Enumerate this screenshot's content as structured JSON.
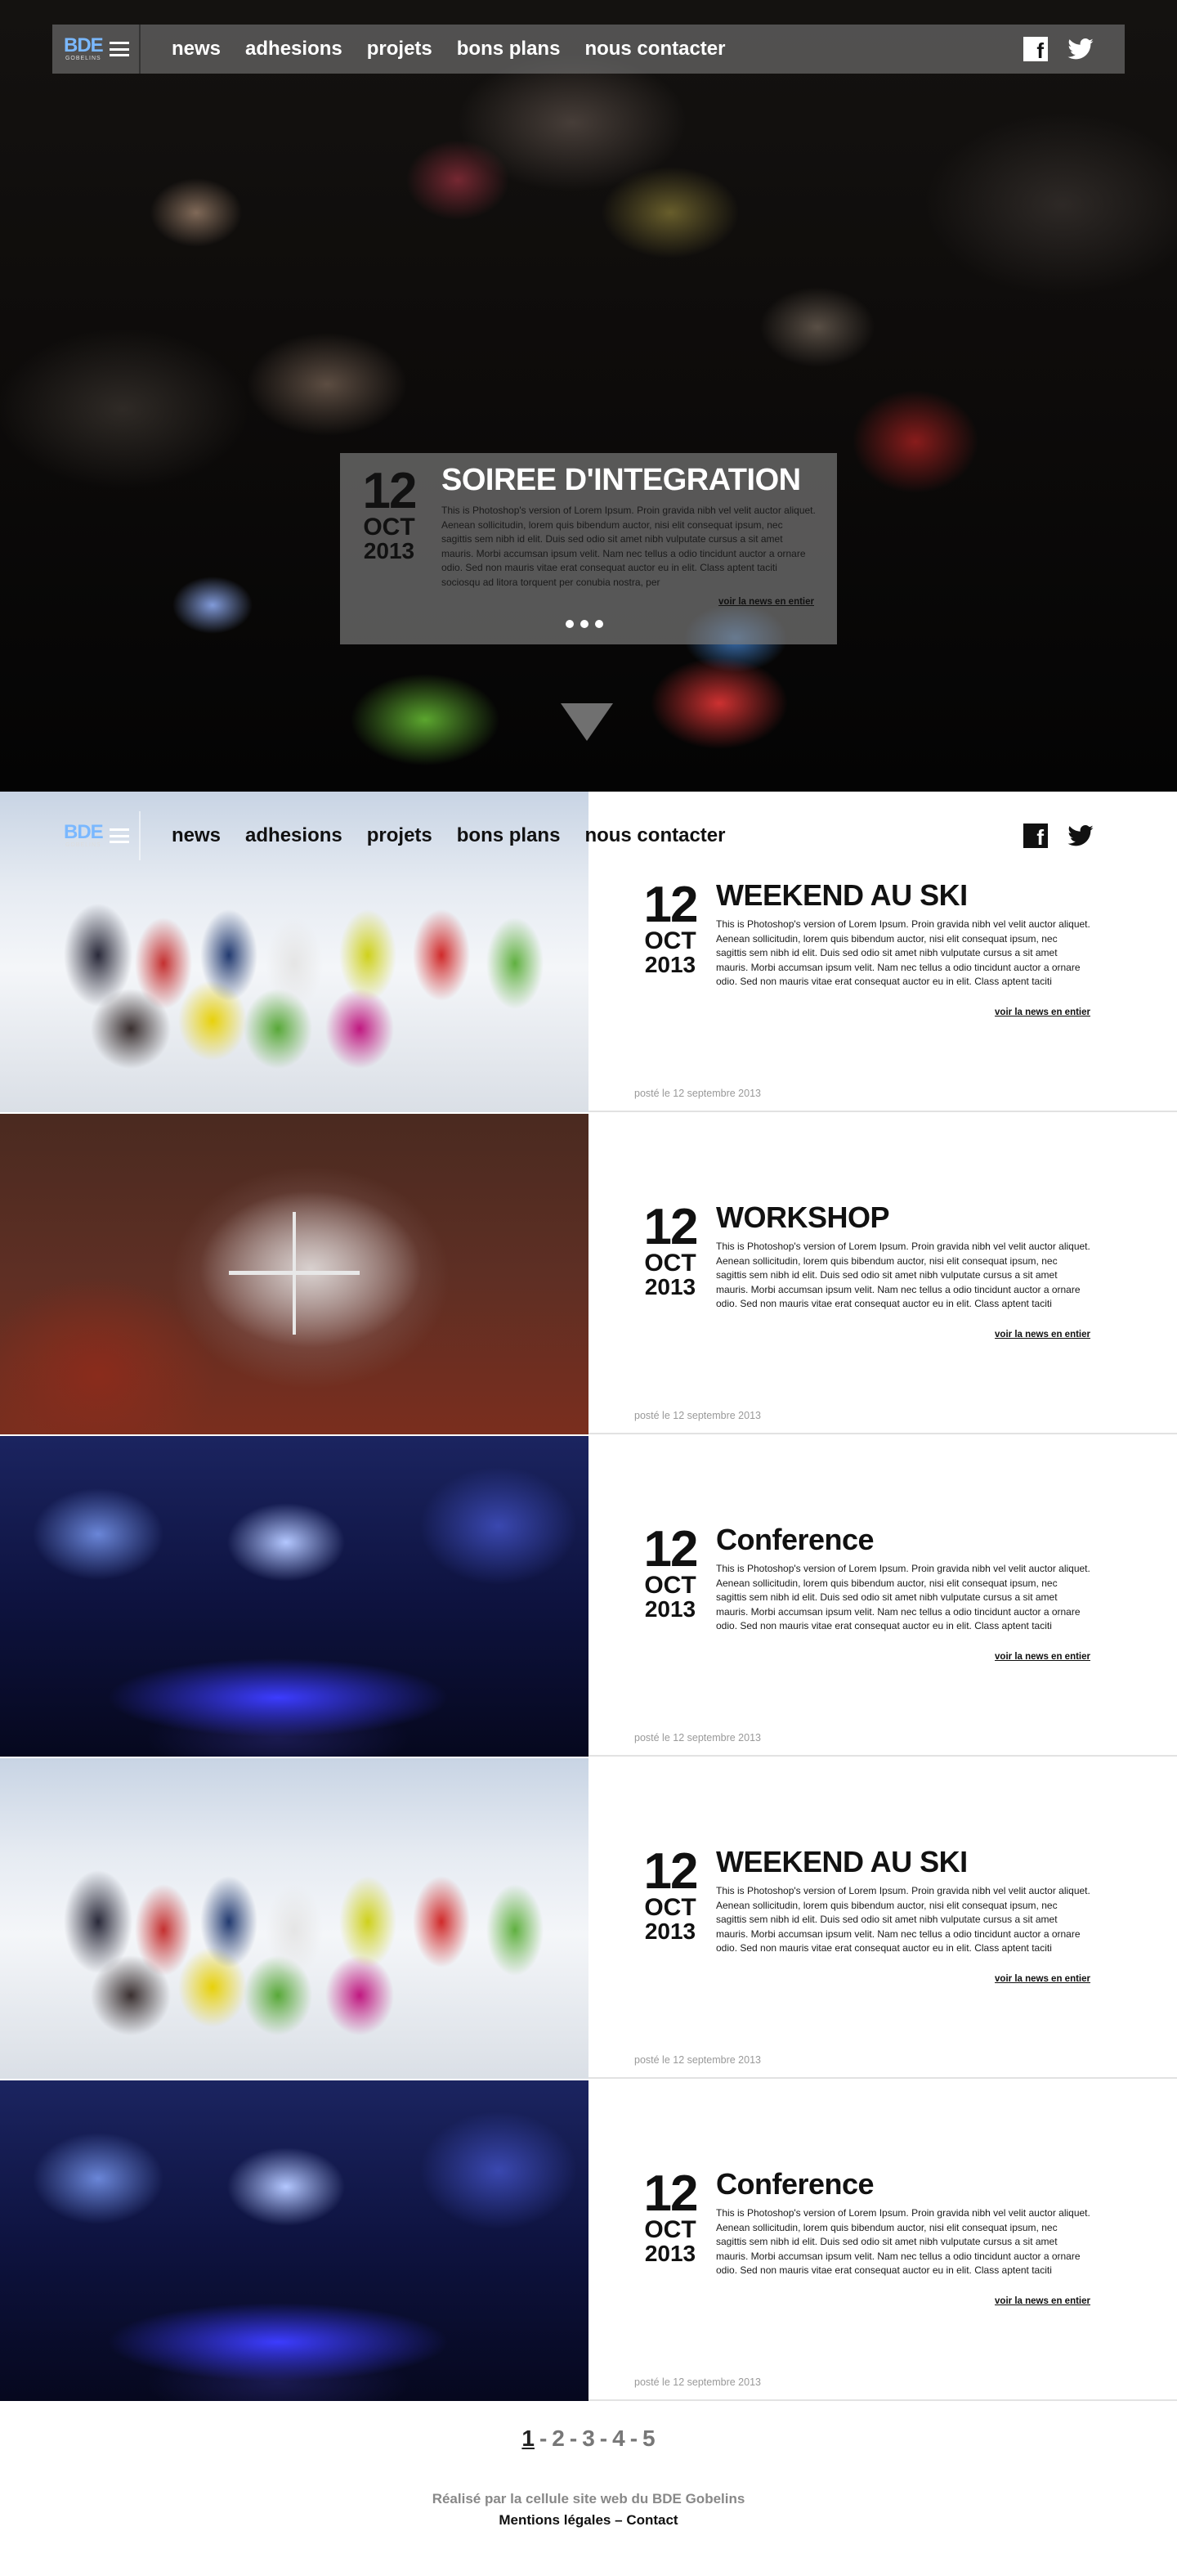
{
  "brand": {
    "logo_text": "BDE",
    "logo_sub": "GOBELINS"
  },
  "nav": {
    "items": [
      "news",
      "adhesions",
      "projets",
      "bons plans",
      "nous contacter"
    ]
  },
  "hero": {
    "date": {
      "day": "12",
      "month": "OCT",
      "year": "2013"
    },
    "title": "SOIREE D'INTEGRATION",
    "text": "This is Photoshop's version  of Lorem Ipsum. Proin gravida nibh vel velit auctor aliquet. Aenean sollicitudin, lorem quis bibendum auctor, nisi elit consequat ipsum, nec sagittis sem nibh id elit. Duis sed odio sit amet nibh vulputate cursus a sit amet mauris. Morbi accumsan ipsum velit. Nam nec tellus a odio tincidunt auctor a ornare odio. Sed non  mauris vitae erat consequat auctor eu in elit. Class aptent taciti sociosqu ad litora torquent per conubia nostra, per",
    "read_more": "voir la news en entier"
  },
  "news": [
    {
      "image": "ski group photo",
      "date": {
        "day": "12",
        "month": "OCT",
        "year": "2013"
      },
      "title": "WEEKEND AU SKI",
      "text": "This is Photoshop's version  of Lorem Ipsum. Proin gravida nibh vel velit auctor aliquet. Aenean sollicitudin, lorem quis bibendum auctor, nisi elit consequat ipsum, nec sagittis sem nibh id elit. Duis sed odio sit amet nibh vulputate cursus a sit amet mauris. Morbi accumsan ipsum velit. Nam nec tellus a odio tincidunt auctor a ornare odio. Sed non  mauris vitae erat consequat auctor eu in elit. Class aptent taciti sociosqu ad litora torquent per conubia nostra, per",
      "read_more": "voir la news en entier",
      "posted": "posté le 12 septembre 2013"
    },
    {
      "image": "workshop photo",
      "date": {
        "day": "12",
        "month": "OCT",
        "year": "2013"
      },
      "title": "WORKSHOP",
      "text": "This is Photoshop's version  of Lorem Ipsum. Proin gravida nibh vel velit auctor aliquet. Aenean sollicitudin, lorem quis bibendum auctor, nisi elit consequat ipsum, nec sagittis sem nibh id elit. Duis sed odio sit amet nibh vulputate cursus a sit amet mauris. Morbi accumsan ipsum velit. Nam nec tellus a odio tincidunt auctor a ornare odio. Sed non  mauris vitae erat consequat auctor eu in elit. Class aptent taciti sociosqu ad litora torquent per conubia nostra, per",
      "read_more": "voir la news en entier",
      "posted": "posté le 12 septembre 2013"
    },
    {
      "image": "conference photo",
      "date": {
        "day": "12",
        "month": "OCT",
        "year": "2013"
      },
      "title": "Conference",
      "text": "This is Photoshop's version  of Lorem Ipsum. Proin gravida nibh vel velit auctor aliquet. Aenean sollicitudin, lorem quis bibendum auctor, nisi elit consequat ipsum, nec sagittis sem nibh id elit. Duis sed odio sit amet nibh vulputate cursus a sit amet mauris. Morbi accumsan ipsum velit. Nam nec tellus a odio tincidunt auctor a ornare odio. Sed non  mauris vitae erat consequat auctor eu in elit. Class aptent taciti sociosqu ad litora torquent per conubia nostra, per",
      "read_more": "voir la news en entier",
      "posted": "posté le 12 septembre 2013"
    },
    {
      "image": "ski group photo",
      "date": {
        "day": "12",
        "month": "OCT",
        "year": "2013"
      },
      "title": "WEEKEND AU SKI",
      "text": "This is Photoshop's version  of Lorem Ipsum. Proin gravida nibh vel velit auctor aliquet. Aenean sollicitudin, lorem quis bibendum auctor, nisi elit consequat ipsum, nec sagittis sem nibh id elit. Duis sed odio sit amet nibh vulputate cursus a sit amet mauris. Morbi accumsan ipsum velit. Nam nec tellus a odio tincidunt auctor a ornare odio. Sed non  mauris vitae erat consequat auctor eu in elit. Class aptent taciti sociosqu ad litora torquent per conubia nostra, per",
      "read_more": "voir la news en entier",
      "posted": "posté le 12 septembre 2013"
    },
    {
      "image": "conference photo",
      "date": {
        "day": "12",
        "month": "OCT",
        "year": "2013"
      },
      "title": "Conference",
      "text": "This is Photoshop's version  of Lorem Ipsum. Proin gravida nibh vel velit auctor aliquet. Aenean sollicitudin, lorem quis bibendum auctor, nisi elit consequat ipsum, nec sagittis sem nibh id elit. Duis sed odio sit amet nibh vulputate cursus a sit amet mauris. Morbi accumsan ipsum velit. Nam nec tellus a odio tincidunt auctor a ornare odio. Sed non  mauris vitae erat consequat auctor eu in elit. Class aptent taciti sociosqu ad litora torquent per conubia nostra, per",
      "read_more": "voir la news en entier",
      "posted": "posté le 12 septembre 2013"
    }
  ],
  "pagination": {
    "pages": [
      "1",
      "2",
      "3",
      "4",
      "5"
    ],
    "current": "1",
    "separator": "-"
  },
  "footer": {
    "credit": "Réalisé par la cellule site web du BDE Gobelins",
    "legal": "Mentions légales",
    "dash": "–",
    "contact": "Contact"
  },
  "icons": [
    "menu-icon",
    "facebook-icon",
    "twitter-icon",
    "scroll-down-icon"
  ],
  "colors": {
    "logo_blue": "#7ab8ff",
    "text_dark": "#111111",
    "muted": "#999999"
  }
}
